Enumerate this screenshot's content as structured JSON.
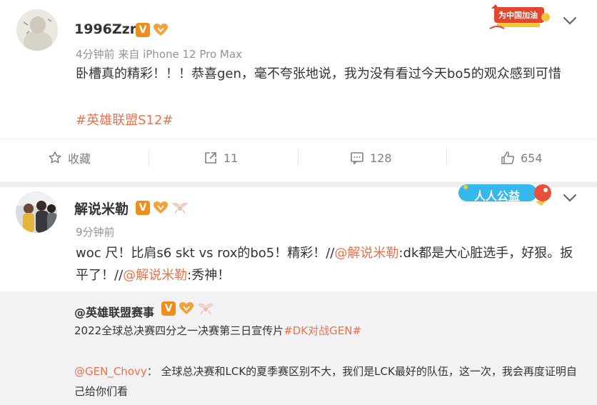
{
  "post1": {
    "username": "1996Zzr",
    "time": "4分钟前",
    "source": "来自 iPhone 12 Pro Max",
    "text": "卧槽真的精彩！！！恭喜gen，毫不夸张地说，我为没有看过今天bo5的观众感到可惜",
    "hashtag": "#英雄联盟S12#",
    "promo": "为中国加油",
    "actions": {
      "favorite": "收藏",
      "repost": "11",
      "comment": "128",
      "like": "654"
    }
  },
  "post2": {
    "username": "解说米勒",
    "time": "9分钟前",
    "text_part1": "woc 尺！比肩s6 skt vs rox的bo5！精彩！//",
    "mention1": "@解说米勒",
    "text_part2": ":dk都是大心脏选手，好狠。扳平了！//",
    "mention2": "@解说米勒",
    "text_part3": ":秀神！",
    "promo": "人人公益"
  },
  "quote": {
    "username": "@英雄联盟赛事",
    "line1_text": "2022全球总决赛四分之一决赛第三日宣传片",
    "line1_tag": "#DK对战GEN#",
    "mention": "@GEN_Chovy",
    "line2_text": "： 全球总决赛和LCK的夏季赛区别不大，我们是LCK最好的队伍，这一次，我会再度证明自己给你们看"
  },
  "colors": {
    "accent": "#eb7350",
    "verified": "#f08c1a",
    "meta": "#939393"
  }
}
